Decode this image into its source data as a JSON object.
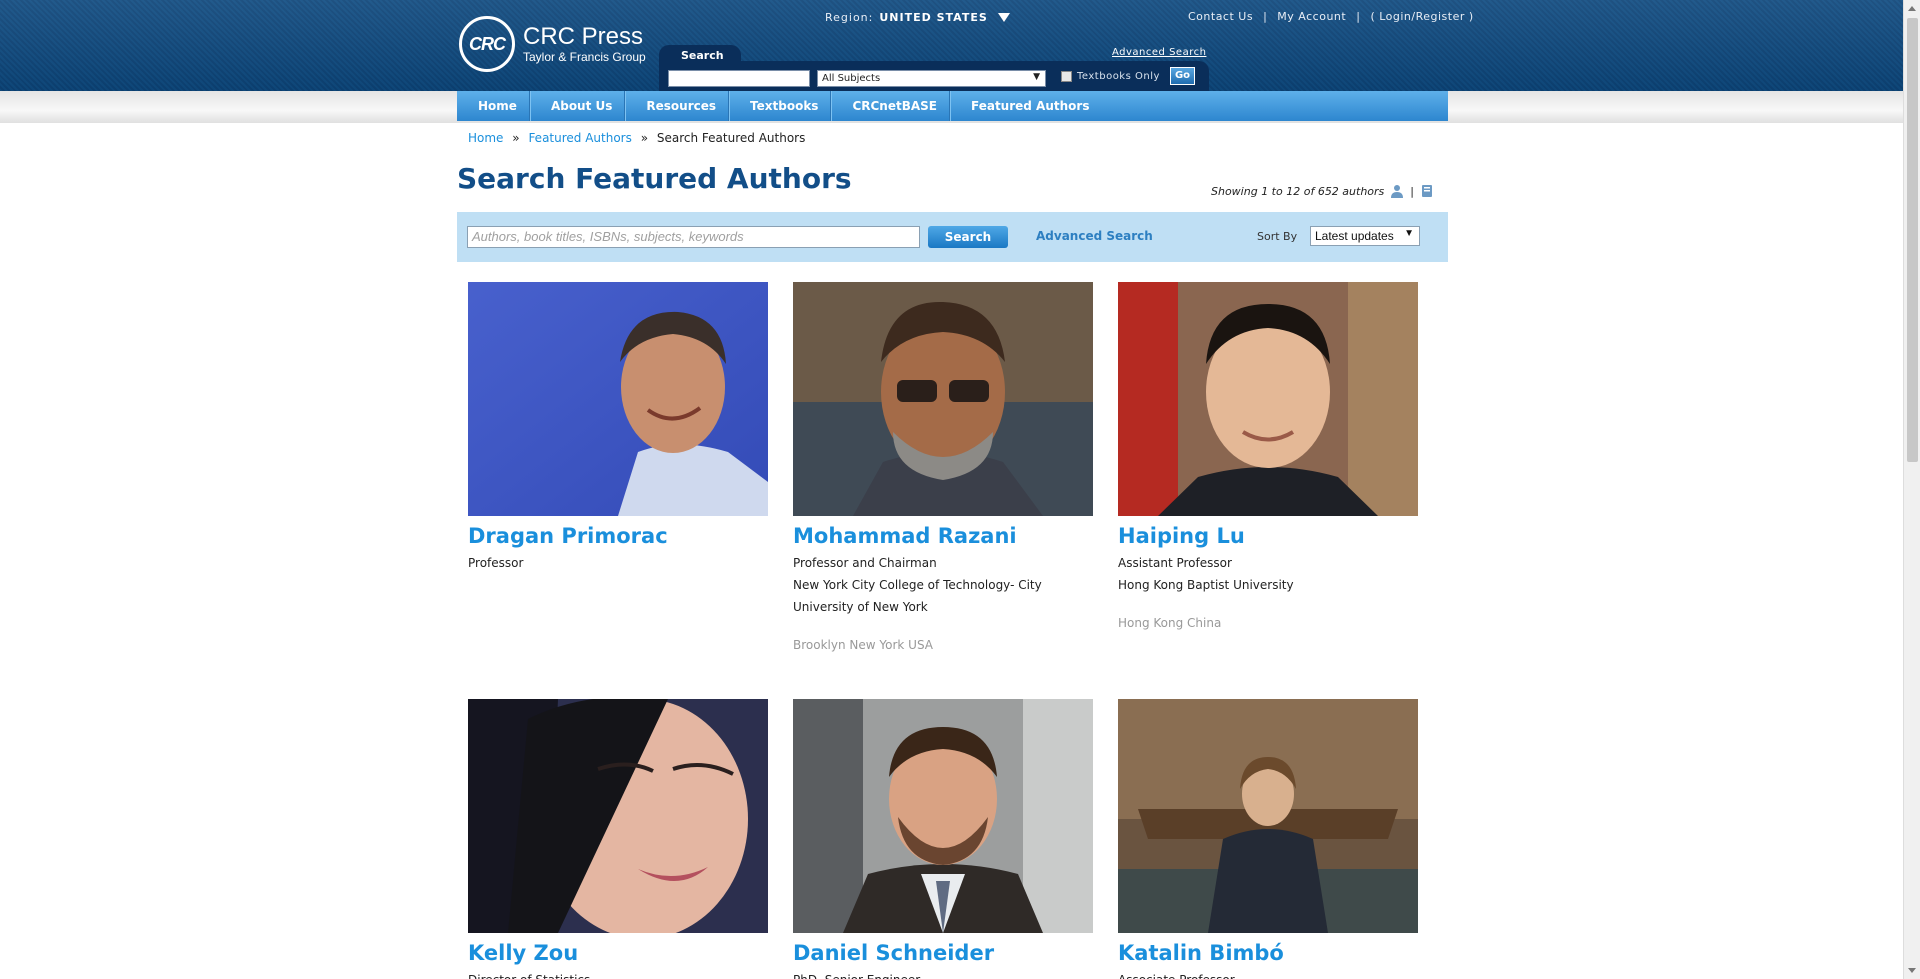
{
  "header": {
    "logo_mark": "CRC",
    "logo_name": "CRC Press",
    "logo_sub": "Taylor & Francis Group",
    "region_label": "Region:",
    "region_value": "UNITED STATES",
    "top_links": [
      "Contact Us",
      "|",
      "My Account",
      "|",
      "( Login/Register )"
    ],
    "search_tab": "Search",
    "advanced_search": "Advanced Search",
    "search_value": "",
    "subject_select": "All Subjects",
    "textbooks_only": "Textbooks Only",
    "go": "Go"
  },
  "nav": [
    "Home",
    "About Us",
    "Resources",
    "Textbooks",
    "CRCnetBASE",
    "Featured Authors"
  ],
  "breadcrumb": {
    "home": "Home",
    "featured": "Featured Authors",
    "current": "Search Featured Authors",
    "sep": "»"
  },
  "page": {
    "title": "Search Featured Authors",
    "showing": "Showing 1 to 12 of 652 authors",
    "pipe": "|"
  },
  "searchbar": {
    "placeholder": "Authors, book titles, ISBNs, subjects, keywords",
    "button": "Search",
    "advanced": "Advanced Search",
    "sort_label": "Sort By",
    "sort_value": "Latest updates"
  },
  "authors": [
    {
      "name": "Dragan Primorac",
      "role": "Professor",
      "org": "",
      "org2": "",
      "location": ""
    },
    {
      "name": "Mohammad Razani",
      "role": "Professor and Chairman",
      "org": "New York City College of Technology- City",
      "org2": "University of New York",
      "location": "Brooklyn New York USA"
    },
    {
      "name": "Haiping Lu",
      "role": "Assistant Professor",
      "org": "Hong Kong Baptist University",
      "org2": "",
      "location": "Hong Kong China"
    },
    {
      "name": "Kelly Zou",
      "role": "Director of Statistics",
      "org": "",
      "org2": "",
      "location": ""
    },
    {
      "name": "Daniel Schneider",
      "role": "PhD, Senior Engineer",
      "org": "",
      "org2": "",
      "location": ""
    },
    {
      "name": "Katalin Bimbó",
      "role": "Associate Professor",
      "org": "",
      "org2": "",
      "location": ""
    }
  ],
  "colors": {
    "header_blue": "#0f4c82",
    "nav_blue": "#2d86cf",
    "link_blue": "#1a8fdc",
    "title_blue": "#124e88",
    "searchbar_bg": "#bfdff4"
  }
}
